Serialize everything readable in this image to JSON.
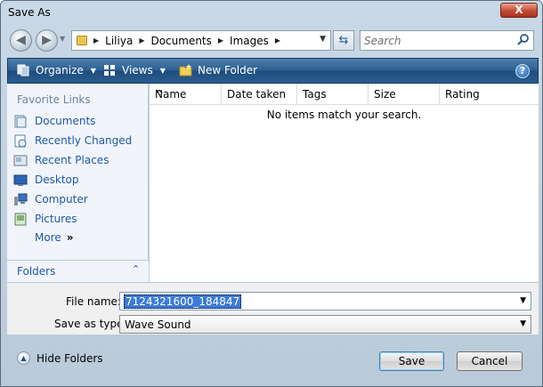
{
  "window": {
    "title": "Save As",
    "close_glyph": "X"
  },
  "address": {
    "crumbs": [
      "Liliya",
      "Documents",
      "Images"
    ],
    "separator": "▶",
    "dropdown": "▼",
    "refresh_glyph": "⇆",
    "back_glyph": "◀",
    "forward_glyph": "▶",
    "history_glyph": "▼"
  },
  "search": {
    "placeholder": "Search"
  },
  "toolbar": {
    "organize": "Organize",
    "views": "Views",
    "new_folder": "New Folder",
    "caret": "▼",
    "help": "?"
  },
  "navpane": {
    "favorites_title": "Favorite Links",
    "items": [
      {
        "label": "Documents",
        "icon": "documents-icon"
      },
      {
        "label": "Recently Changed",
        "icon": "recently-changed-icon"
      },
      {
        "label": "Recent Places",
        "icon": "recent-places-icon"
      },
      {
        "label": "Desktop",
        "icon": "desktop-icon"
      },
      {
        "label": "Computer",
        "icon": "computer-icon"
      },
      {
        "label": "Pictures",
        "icon": "pictures-icon"
      }
    ],
    "more": "More",
    "more_glyph": "»",
    "folders": "Folders",
    "folders_glyph": "⌃"
  },
  "list": {
    "columns": [
      "Name",
      "Date taken",
      "Tags",
      "Size",
      "Rating"
    ],
    "sort_glyph": "^",
    "empty_message": "No items match your search."
  },
  "form": {
    "file_name_label": "File name:",
    "file_name_value": "7124321600_184847",
    "save_type_label": "Save as type:",
    "save_type_value": "Wave Sound",
    "dropdown_glyph": "▼"
  },
  "footer": {
    "hide_folders": "Hide Folders",
    "hide_glyph": "▲",
    "save": "Save",
    "cancel": "Cancel"
  },
  "colors": {
    "toolbar": "#2b5e8f",
    "link": "#1f58a6",
    "selection": "#3d7ad6"
  }
}
